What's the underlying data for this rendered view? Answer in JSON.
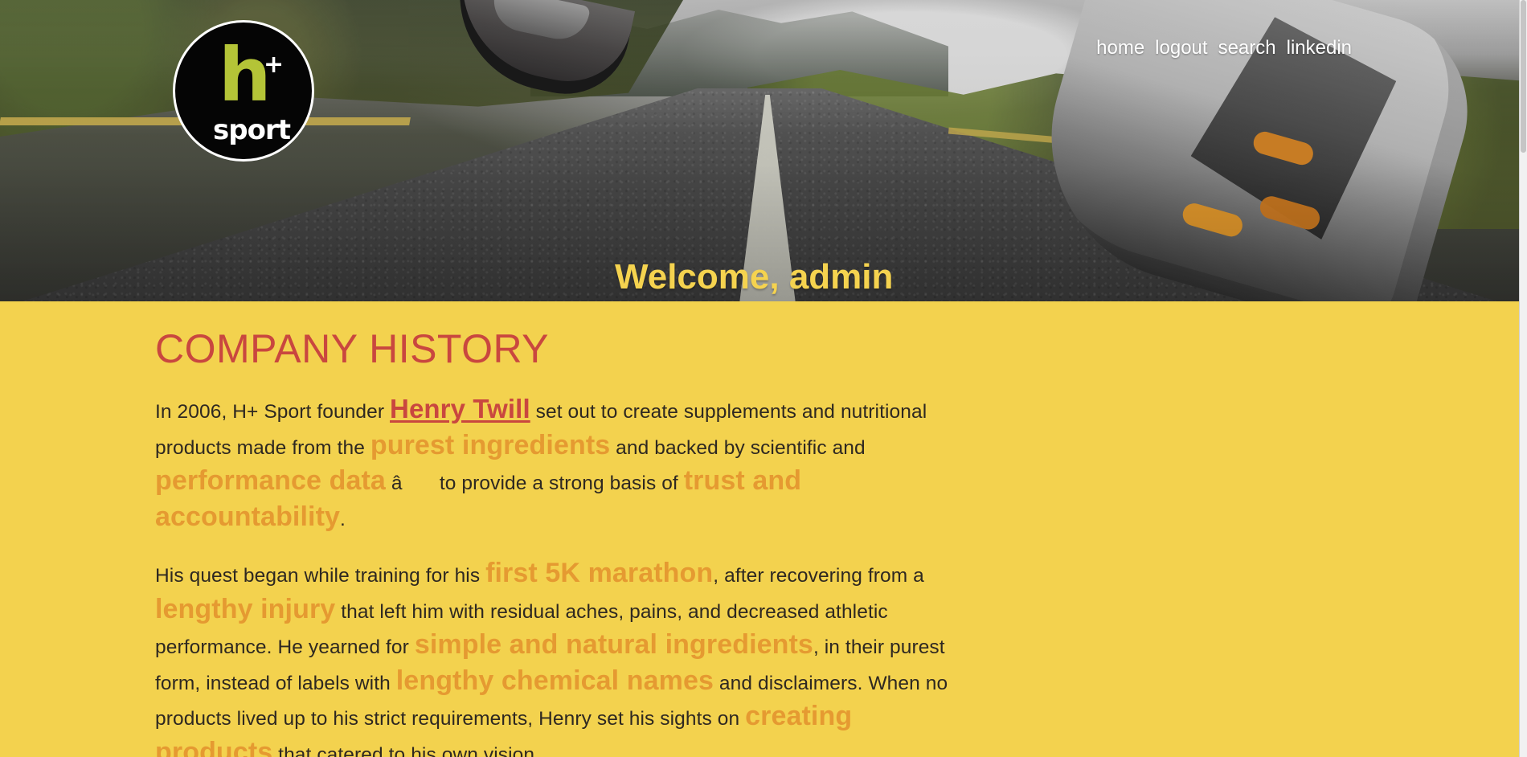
{
  "header": {
    "logo": {
      "brand_mark": "h",
      "brand_plus": "+",
      "brand_word": "sport"
    },
    "nav": [
      {
        "label": "home"
      },
      {
        "label": "logout"
      },
      {
        "label": "search"
      },
      {
        "label": "linkedin"
      }
    ],
    "welcome": "Welcome, admin"
  },
  "main": {
    "title": "COMPANY HISTORY",
    "paragraph1": {
      "part1": "In 2006, H+ Sport founder ",
      "founder_link": "Henry Twill",
      "part2": " set out to create supplements and nutritional products made from the ",
      "highlight1": "purest ingredients",
      "part3": " and backed by scientific and ",
      "highlight2": "performance data",
      "part4": " â to provide a strong basis of ",
      "highlight3": "trust and accountability",
      "part5": "."
    },
    "paragraph2": {
      "part1": "His quest began while training for his ",
      "highlight1": "first 5K marathon",
      "part2": ", after recovering from a ",
      "highlight2": "lengthy injury",
      "part3": " that left him with residual aches, pains, and decreased athletic performance. He yearned for ",
      "highlight3": "simple and natural ingredients",
      "part4": ", in their purest form, instead of labels with ",
      "highlight4": "lengthy chemical names",
      "part5": " and disclaimers. When no products lived up to his strict requirements, Henry set his sights on ",
      "highlight5": "creating products",
      "part6": " that catered to his own vision."
    }
  },
  "colors": {
    "background": "#f3d24e",
    "heading": "#c9473f",
    "highlight": "#e59a31",
    "welcome": "#f5d34f",
    "logo_green": "#b4c437"
  },
  "icons": {
    "logo": "h-plus-sport-logo"
  }
}
